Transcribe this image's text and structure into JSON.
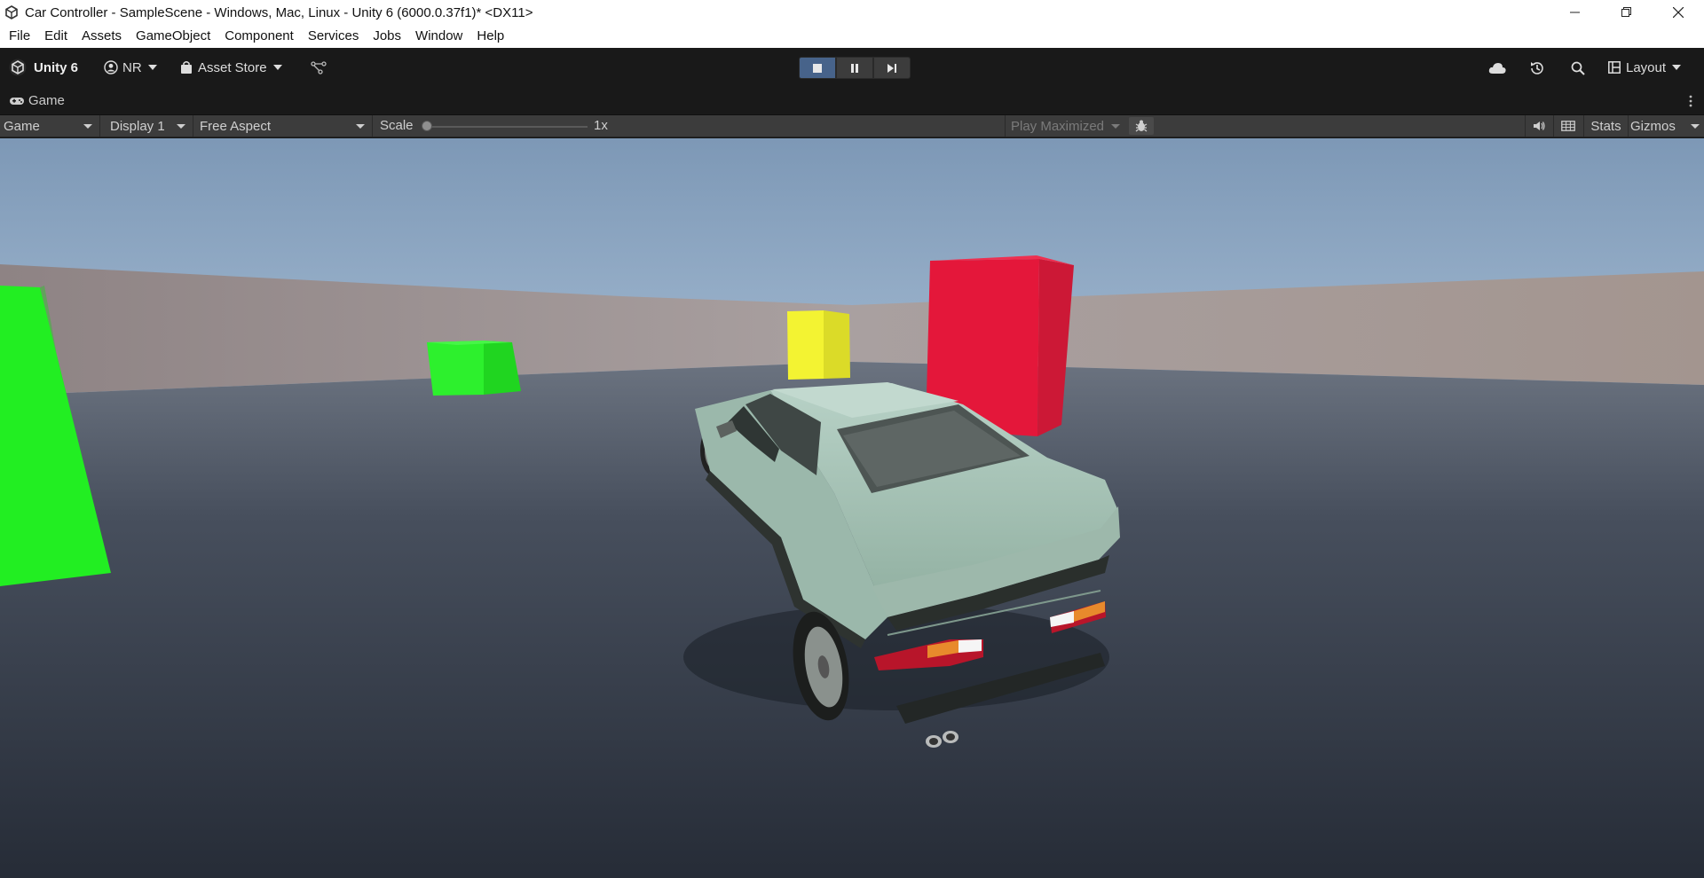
{
  "window": {
    "title": "Car Controller - SampleScene - Windows, Mac, Linux - Unity 6 (6000.0.37f1)* <DX11>",
    "controls": [
      "minimize-icon",
      "restore-icon",
      "close-icon"
    ]
  },
  "menu": {
    "items": [
      "File",
      "Edit",
      "Assets",
      "GameObject",
      "Component",
      "Services",
      "Jobs",
      "Window",
      "Help"
    ]
  },
  "toolbar": {
    "unity_label": "Unity 6",
    "account_label": "NR",
    "asset_store_label": "Asset Store",
    "layout_label": "Layout",
    "play_state": "playing"
  },
  "game_tab": {
    "label": "Game"
  },
  "game_toolbar": {
    "view_mode": "Game",
    "display": "Display 1",
    "aspect": "Free Aspect",
    "scale_label": "Scale",
    "scale_value": "1x",
    "scale_fraction": 0.0,
    "play_mode": "Play Maximized",
    "stats_label": "Stats",
    "gizmos_label": "Gizmos"
  },
  "scene": {
    "objects": [
      "green-cube-left",
      "green-cube-small",
      "yellow-cube",
      "red-cube",
      "car"
    ],
    "colors": {
      "sky_top": "#7f9bb8",
      "sky_horizon": "#dbe7f1",
      "wall": "#9c9293",
      "ground": "#3c4452",
      "green": "#22ee22",
      "yellow": "#f0f030",
      "red": "#e3163a",
      "car_body": "#a9c7bb"
    }
  }
}
